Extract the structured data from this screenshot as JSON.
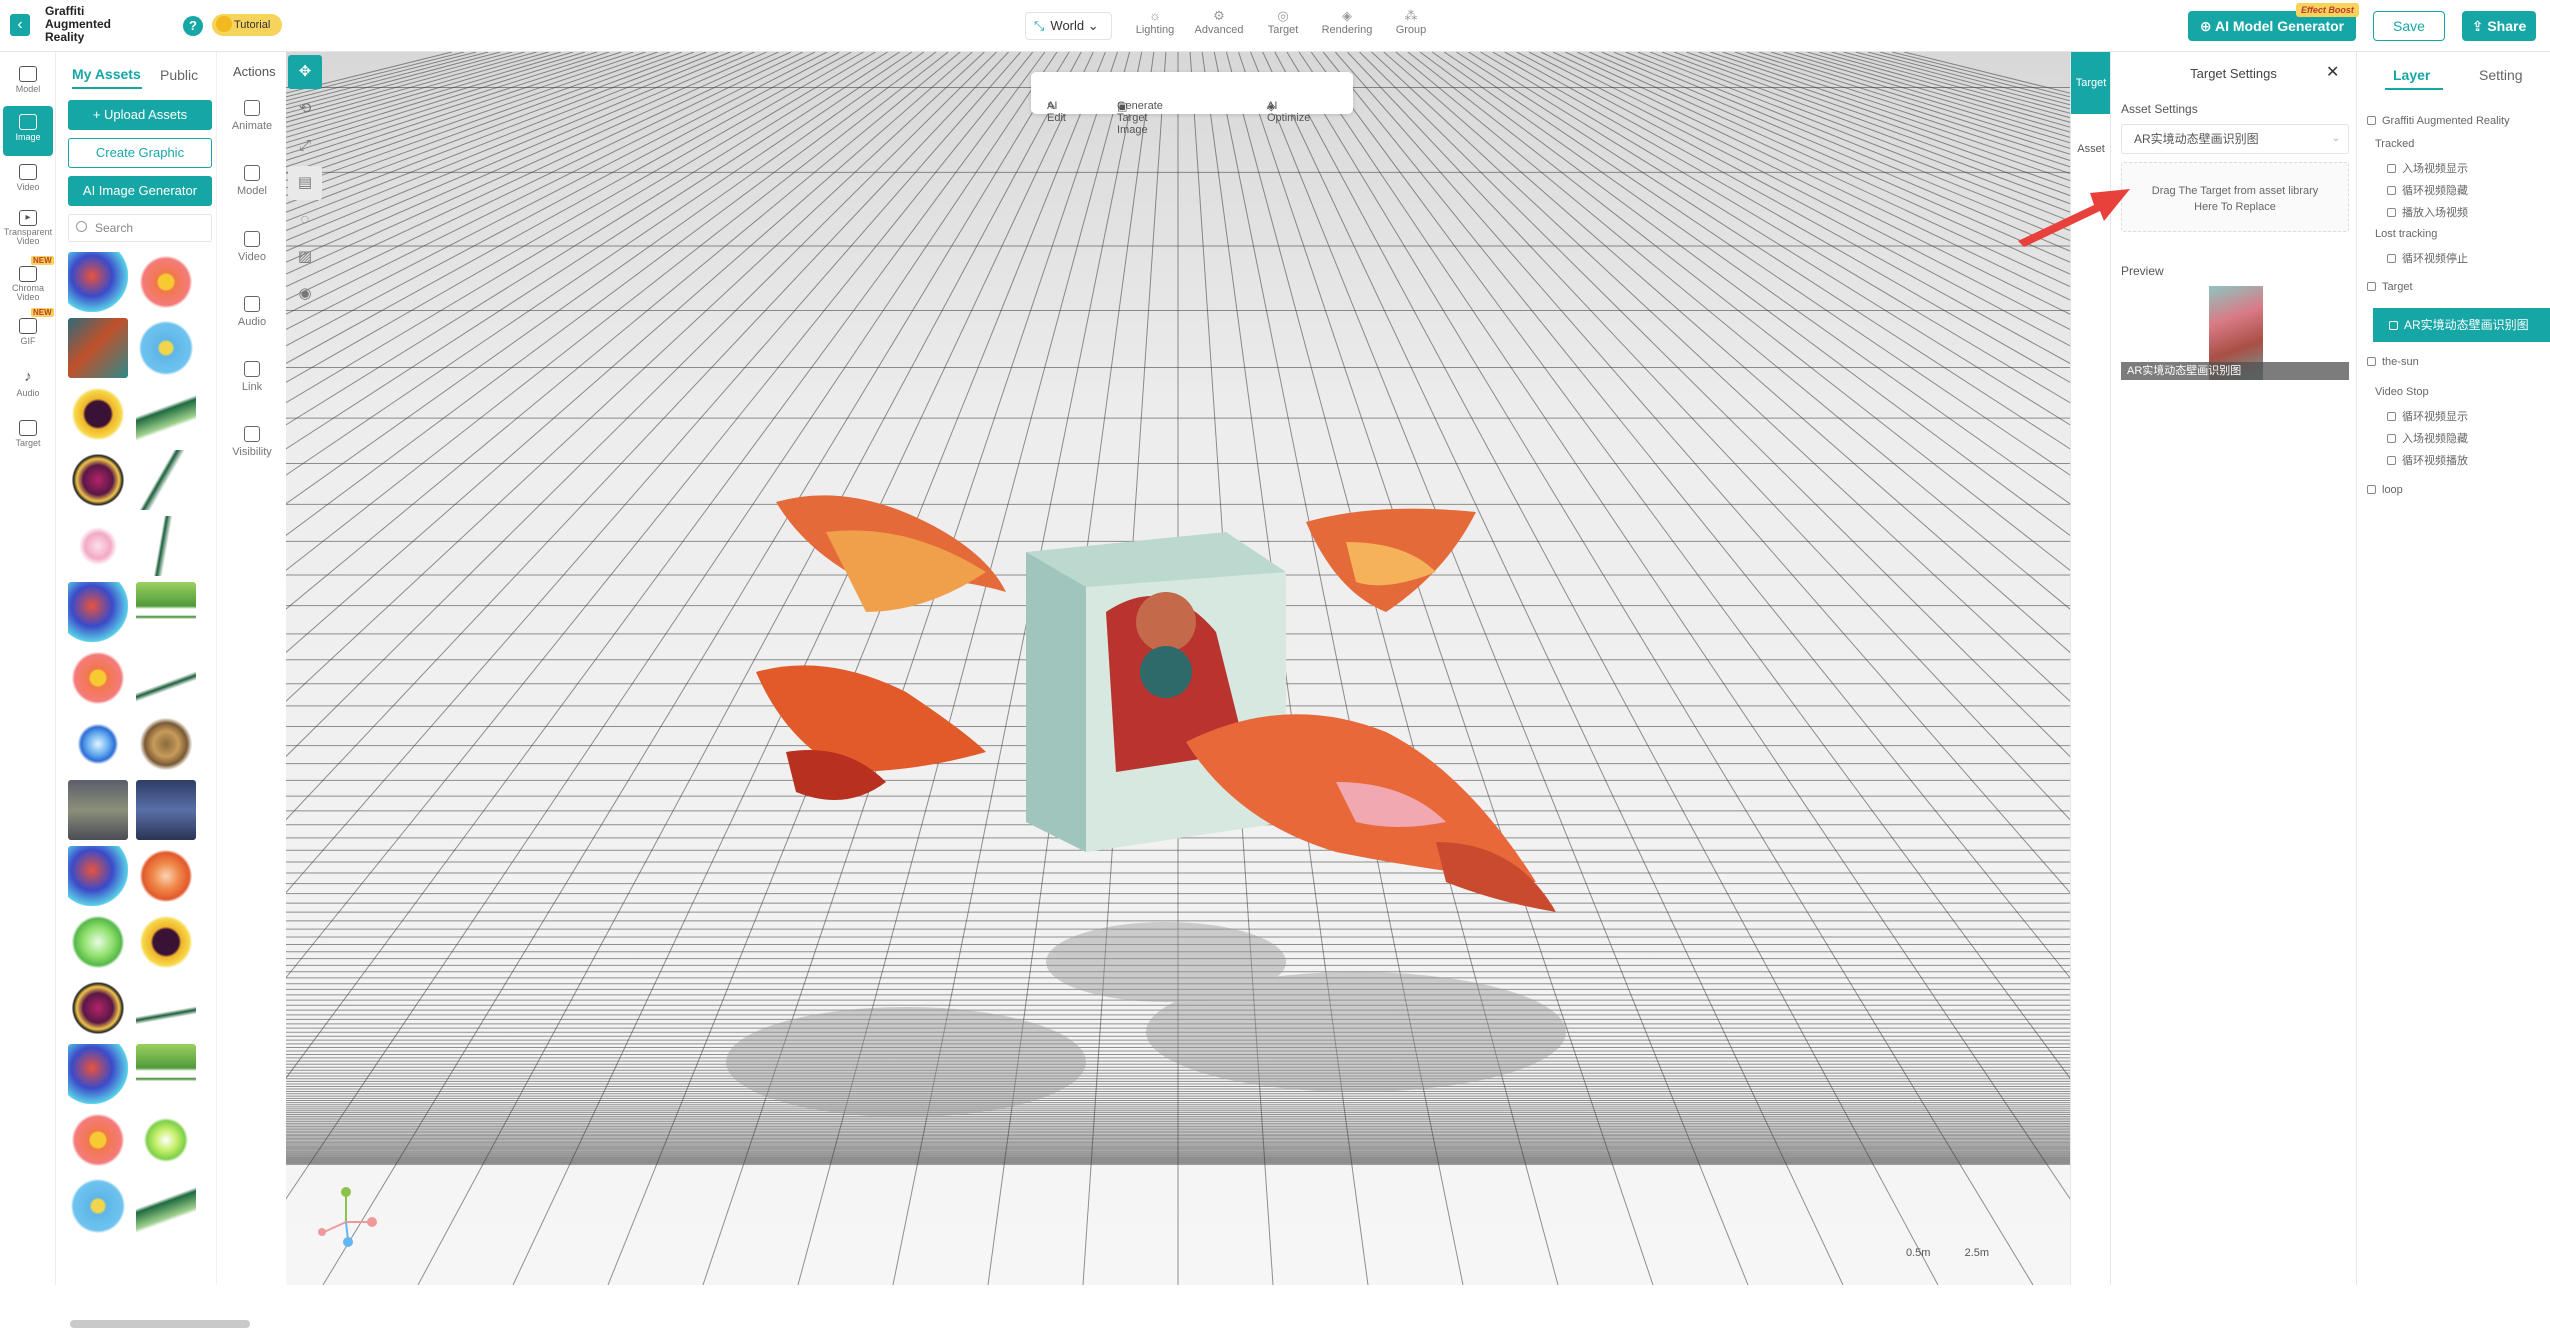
{
  "header": {
    "project_title": "Graffiti Augmented Reality",
    "help_label": "?",
    "tutorial_label": "Tutorial",
    "world_label": "World",
    "tools": [
      "Lighting",
      "Advanced",
      "Target",
      "Rendering",
      "Group"
    ],
    "ai_model_label": "AI Model Generator",
    "effect_boost_label": "Effect Boost",
    "save_label": "Save",
    "share_label": "Share"
  },
  "iconbar": {
    "items": [
      "Model",
      "Image",
      "Video",
      "Transparent Video",
      "Chroma Video",
      "GIF",
      "Audio",
      "Target"
    ],
    "new_badge": "NEW"
  },
  "assets": {
    "tab_my": "My Assets",
    "tab_public": "Public",
    "upload_label": "+ Upload Assets",
    "create_label": "Create Graphic",
    "ai_image_label": "AI Image Generator",
    "search_placeholder": "Search"
  },
  "actions": {
    "title": "Actions",
    "items": [
      "Animate",
      "Model",
      "Video",
      "Audio",
      "Link",
      "Visibility"
    ]
  },
  "viewport": {
    "ai_edit": "AI Edit",
    "generate_target": "Generate Target Image",
    "ai_optimize": "AI Optimize",
    "scale_small": "0.5m",
    "scale_large": "2.5m"
  },
  "side_tabs": {
    "target": "Target",
    "asset": "Asset"
  },
  "target_settings": {
    "title": "Target Settings",
    "asset_settings_label": "Asset Settings",
    "selected_asset": "AR实境动态壁画识别图",
    "drop_hint_line1": "Drag The Target from asset library",
    "drop_hint_line2": "Here To Replace",
    "preview_label": "Preview",
    "preview_caption": "AR实境动态壁画识别图"
  },
  "layer_panel": {
    "tab_layer": "Layer",
    "tab_setting": "Setting",
    "root": "Graffiti Augmented Reality",
    "tracked": "Tracked",
    "tracked_items": [
      "入场视频显示",
      "循环视频隐藏",
      "播放入场视频"
    ],
    "lost_tracking": "Lost tracking",
    "lost_items": [
      "循环视频停止"
    ],
    "target": "Target",
    "target_selected": "AR实境动态壁画识别图",
    "the_sun": "the-sun",
    "video_stop": "Video Stop",
    "video_stop_items": [
      "循环视频显示",
      "入场视频隐藏",
      "循环视频播放"
    ],
    "loop": "loop"
  },
  "colors": {
    "accent": "#17a6a6",
    "badge": "#f6d35b",
    "arrow": "#e8403a"
  }
}
